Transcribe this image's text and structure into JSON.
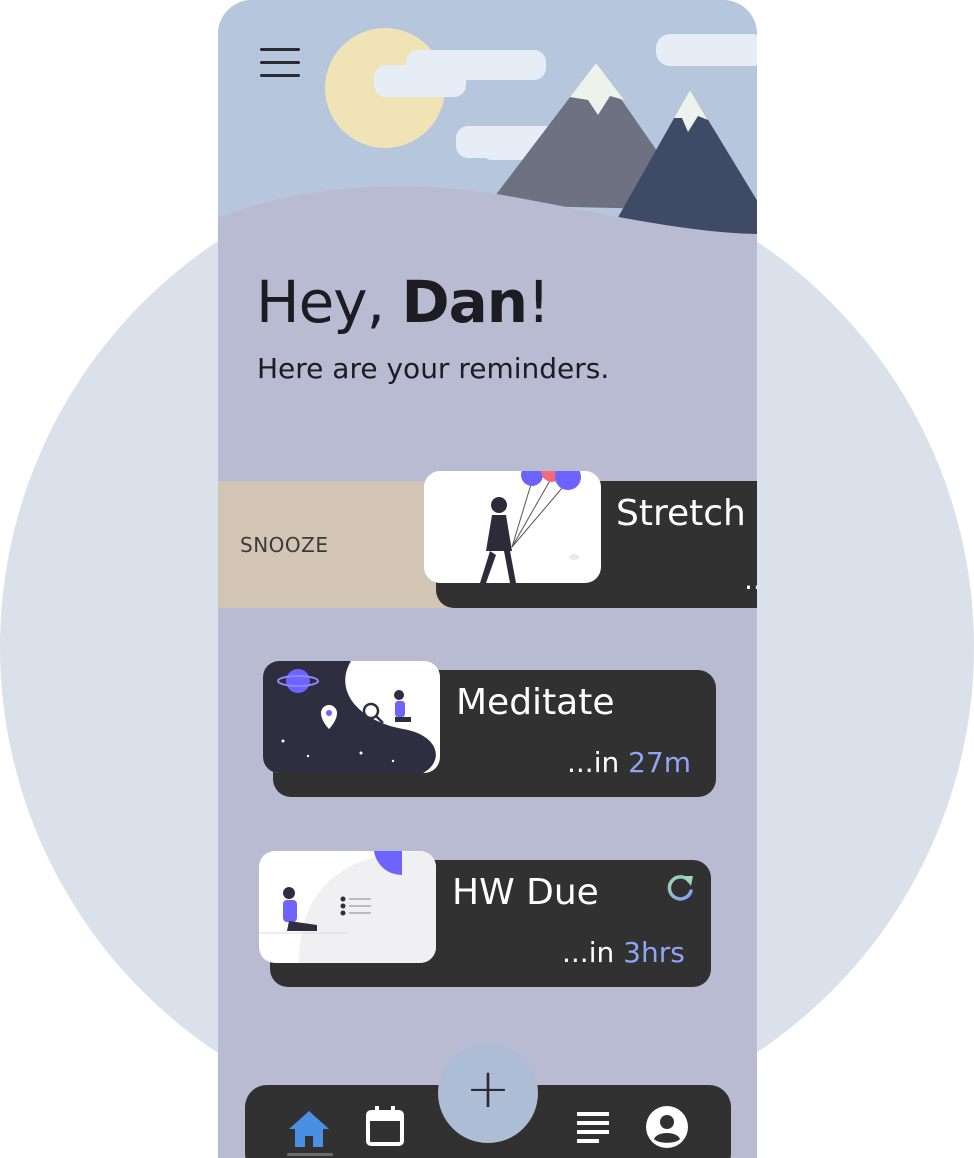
{
  "greeting": {
    "prefix": "Hey, ",
    "name": "Dan",
    "suffix": "!"
  },
  "subtitle": "Here are your reminders.",
  "swipe_action": {
    "label": "SNOOZE"
  },
  "reminders": [
    {
      "title": "Stretch",
      "time_prefix": "..",
      "time_value": ""
    },
    {
      "title": "Meditate",
      "time_prefix": "...in ",
      "time_value": "27m"
    },
    {
      "title": "HW Due",
      "time_prefix": "...in ",
      "time_value": "3hrs",
      "recurring": true
    }
  ],
  "nav": {
    "items": [
      "home-icon",
      "calendar-icon",
      "list-icon",
      "profile-icon"
    ],
    "fab_label": "+"
  },
  "colors": {
    "accent": "#8fa5f3",
    "card": "#313131",
    "home_active": "#4a90e2",
    "fab": "#aebdd6"
  }
}
